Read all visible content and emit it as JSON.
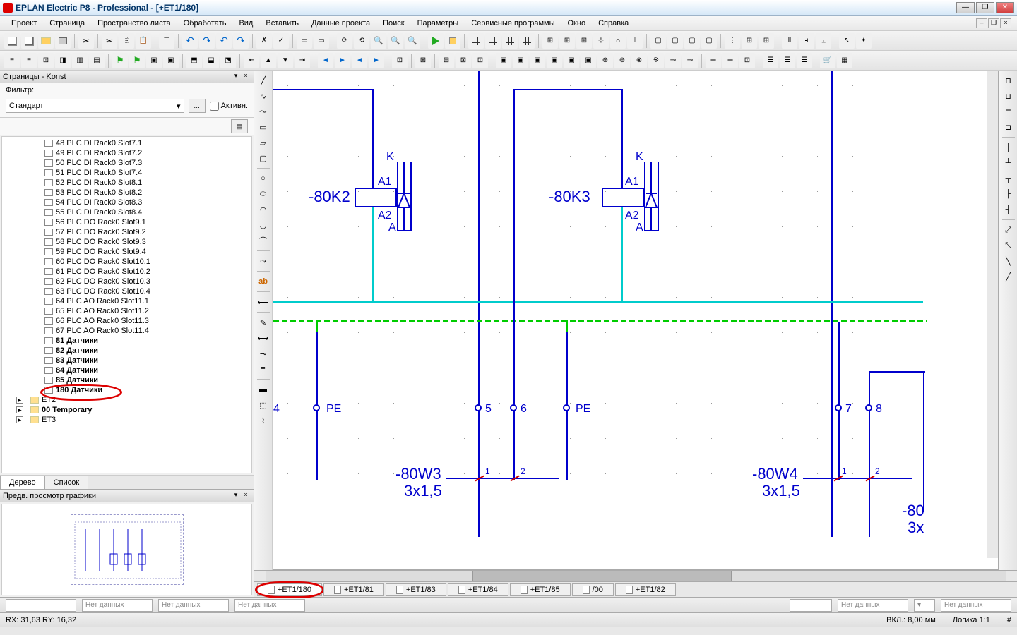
{
  "title": "EPLAN Electric P8 - Professional - [+ET1/180]",
  "menu": [
    "Проект",
    "Страница",
    "Пространство листа",
    "Обработать",
    "Вид",
    "Вставить",
    "Данные проекта",
    "Поиск",
    "Параметры",
    "Сервисные программы",
    "Окно",
    "Справка"
  ],
  "left": {
    "panel_title": "Страницы - Konst",
    "filter_label": "Фильтр:",
    "filter_value": "Стандарт",
    "active_label": "Активн.",
    "tabs": [
      "Дерево",
      "Список"
    ],
    "preview_title": "Предв. просмотр графики",
    "tree": [
      {
        "label": "48 PLC DI Rack0 Slot7.1",
        "bold": false
      },
      {
        "label": "49 PLC DI Rack0 Slot7.2",
        "bold": false
      },
      {
        "label": "50 PLC DI Rack0 Slot7.3",
        "bold": false
      },
      {
        "label": "51 PLC DI Rack0 Slot7.4",
        "bold": false
      },
      {
        "label": "52 PLC DI Rack0 Slot8.1",
        "bold": false
      },
      {
        "label": "53 PLC DI Rack0 Slot8.2",
        "bold": false
      },
      {
        "label": "54 PLC DI Rack0 Slot8.3",
        "bold": false
      },
      {
        "label": "55 PLC DI Rack0 Slot8.4",
        "bold": false
      },
      {
        "label": "56 PLC DO Rack0 Slot9.1",
        "bold": false
      },
      {
        "label": "57 PLC DO Rack0 Slot9.2",
        "bold": false
      },
      {
        "label": "58 PLC DO Rack0 Slot9.3",
        "bold": false
      },
      {
        "label": "59 PLC DO Rack0 Slot9.4",
        "bold": false
      },
      {
        "label": "60 PLC DO Rack0 Slot10.1",
        "bold": false
      },
      {
        "label": "61 PLC DO Rack0 Slot10.2",
        "bold": false
      },
      {
        "label": "62 PLC DO Rack0 Slot10.3",
        "bold": false
      },
      {
        "label": "63 PLC DO Rack0 Slot10.4",
        "bold": false
      },
      {
        "label": "64 PLC AO Rack0 Slot11.1",
        "bold": false
      },
      {
        "label": "65 PLC AO Rack0 Slot11.2",
        "bold": false
      },
      {
        "label": "66 PLC AO Rack0 Slot11.3",
        "bold": false
      },
      {
        "label": "67 PLC AO Rack0 Slot11.4",
        "bold": false
      },
      {
        "label": "81 Датчики",
        "bold": true
      },
      {
        "label": "82 Датчики",
        "bold": true
      },
      {
        "label": "83 Датчики",
        "bold": true
      },
      {
        "label": "84 Датчики",
        "bold": true
      },
      {
        "label": "85 Датчики",
        "bold": true
      },
      {
        "label": "180 Датчики",
        "bold": true,
        "selected": true
      }
    ],
    "tree_roots": [
      {
        "label": "ET2"
      },
      {
        "label": "00 Temporary",
        "bold": true
      },
      {
        "label": "ET3"
      }
    ]
  },
  "sheets": [
    {
      "label": "+ET1/180",
      "active": true,
      "circled": true
    },
    {
      "label": "+ET1/81"
    },
    {
      "label": "+ET1/83"
    },
    {
      "label": "+ET1/84"
    },
    {
      "label": "+ET1/85"
    },
    {
      "label": "/00"
    },
    {
      "label": "+ET1/82"
    }
  ],
  "schematic": {
    "relay1": {
      "name": "-80K2",
      "k": "K",
      "a1": "A1",
      "a2": "A2",
      "a": "A"
    },
    "relay2": {
      "name": "-80K3",
      "k": "K",
      "a1": "A1",
      "a2": "A2",
      "a": "A"
    },
    "cable1": {
      "name": "-80W3",
      "spec": "3x1,5"
    },
    "cable2": {
      "name": "-80W4",
      "spec": "3x1,5"
    },
    "cable3": {
      "name": "-80",
      "spec": "3x"
    },
    "pe": "PE",
    "t4": "4",
    "t5": "5",
    "t6": "6",
    "t7": "7",
    "t8": "8",
    "w1": "1",
    "w2": "2"
  },
  "prop_bar": {
    "nodata": "Нет данных"
  },
  "status": {
    "coords": "RX: 31,63    RY: 16,32",
    "snap": "ВКЛ.: 8,00 мм",
    "logic": "Логика 1:1",
    "hash": "#"
  }
}
